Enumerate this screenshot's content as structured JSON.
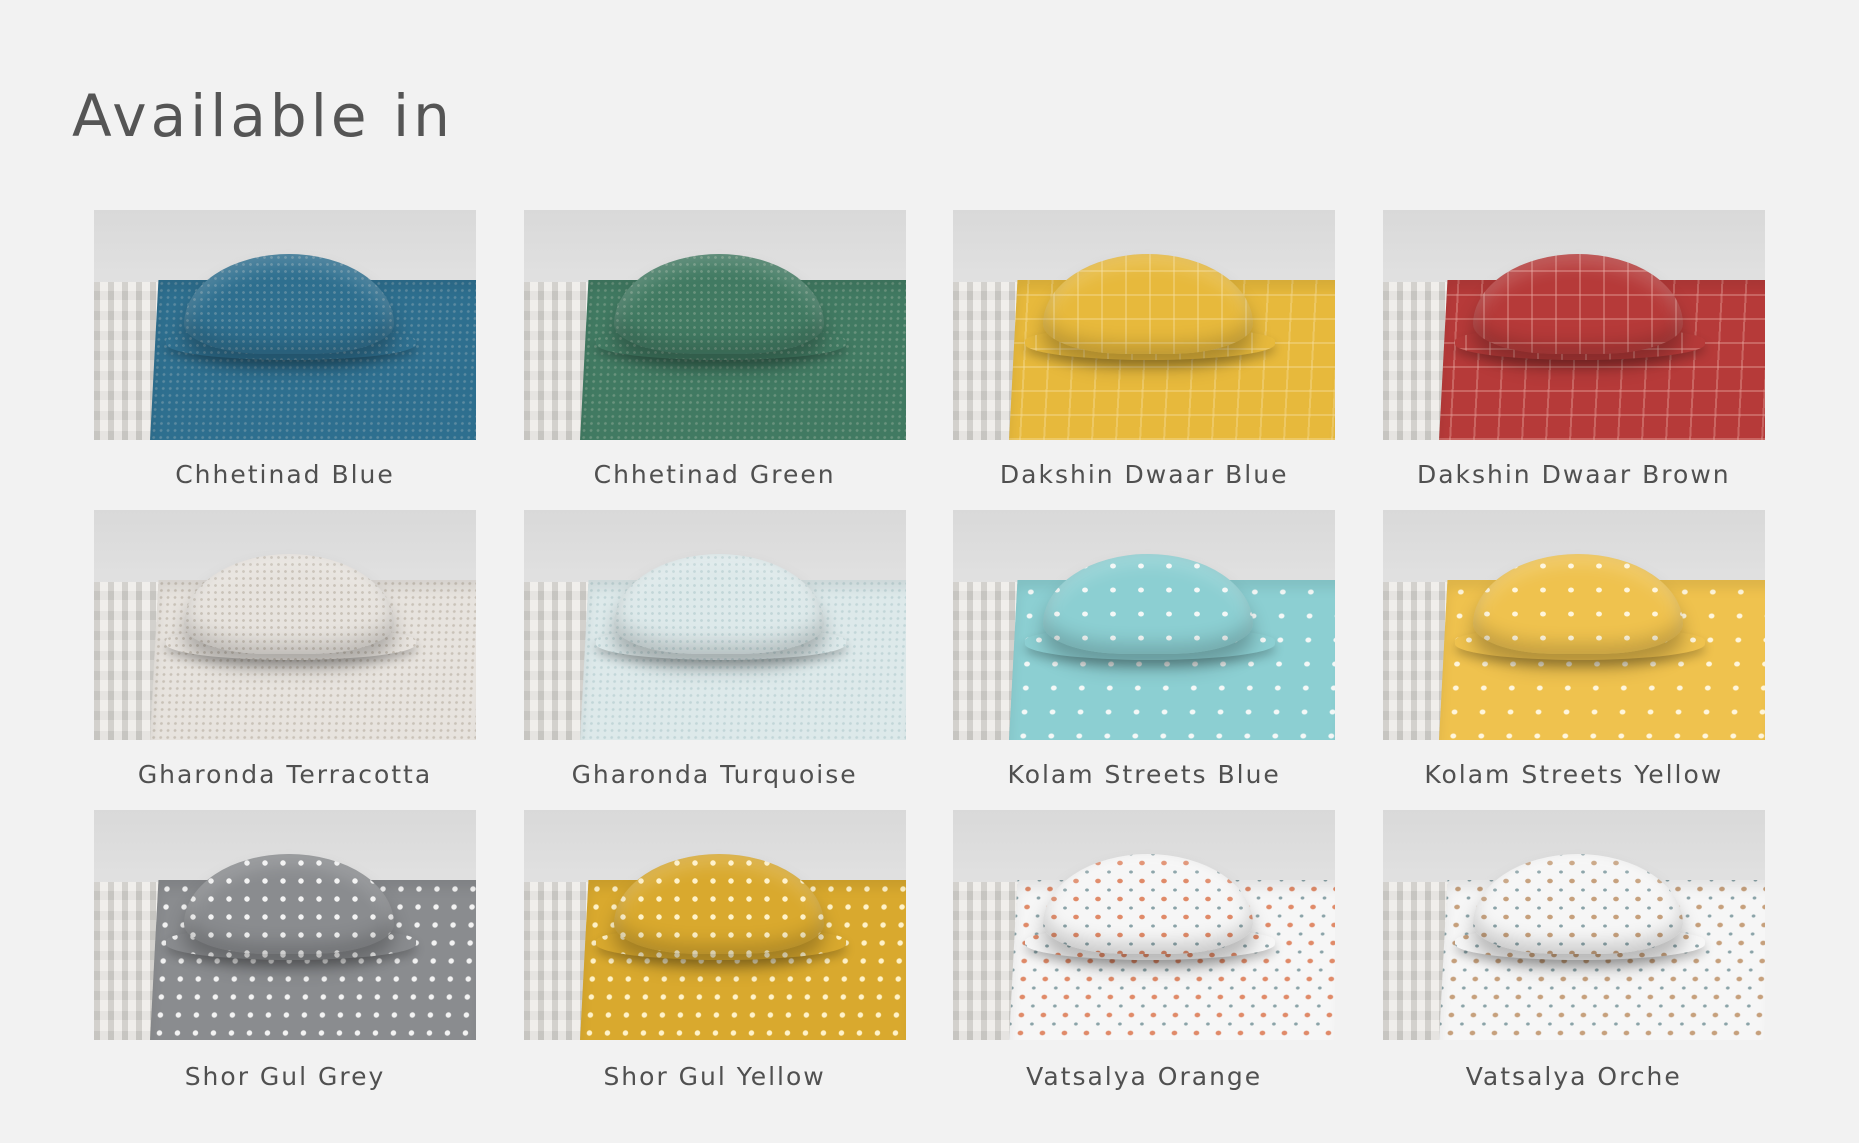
{
  "header": {
    "title": "Available in"
  },
  "variants": [
    {
      "label": "Chhetinad Blue",
      "color": "#2e6f8f",
      "pattern": "dense-dots",
      "accent": "#5b8aa0"
    },
    {
      "label": "Chhetinad Green",
      "color": "#417a62",
      "pattern": "dense-dots",
      "accent": "#69937d"
    },
    {
      "label": "Dakshin Dwaar Blue",
      "color": "#e7b93c",
      "pattern": "motif",
      "accent": "#f6dfa0"
    },
    {
      "label": "Dakshin Dwaar Brown",
      "color": "#b63a39",
      "pattern": "motif",
      "accent": "#e8a7a0"
    },
    {
      "label": "Gharonda Terracotta",
      "color": "#e7e3de",
      "pattern": "dense-dots",
      "accent": "#c9c2b8"
    },
    {
      "label": "Gharonda Turquoise",
      "color": "#dde9ea",
      "pattern": "dense-dots",
      "accent": "#c2d6d8"
    },
    {
      "label": "Kolam Streets Blue",
      "color": "#8ccfd2",
      "pattern": "sparse-dots",
      "accent": "#f4f8f7"
    },
    {
      "label": "Kolam Streets Yellow",
      "color": "#efc24e",
      "pattern": "sparse-dots",
      "accent": "#fff6dc"
    },
    {
      "label": "Shor Gul Grey",
      "color": "#8a8c8f",
      "pattern": "polka",
      "accent": "#f3f3f3"
    },
    {
      "label": "Shor Gul Yellow",
      "color": "#d9a92e",
      "pattern": "polka",
      "accent": "#fff2c8"
    },
    {
      "label": "Vatsalya Orange",
      "color": "#f6f6f6",
      "pattern": "flower",
      "accent": "#e08a68"
    },
    {
      "label": "Vatsalya Orche",
      "color": "#f6f6f6",
      "pattern": "flower",
      "accent": "#c6a07c"
    }
  ]
}
